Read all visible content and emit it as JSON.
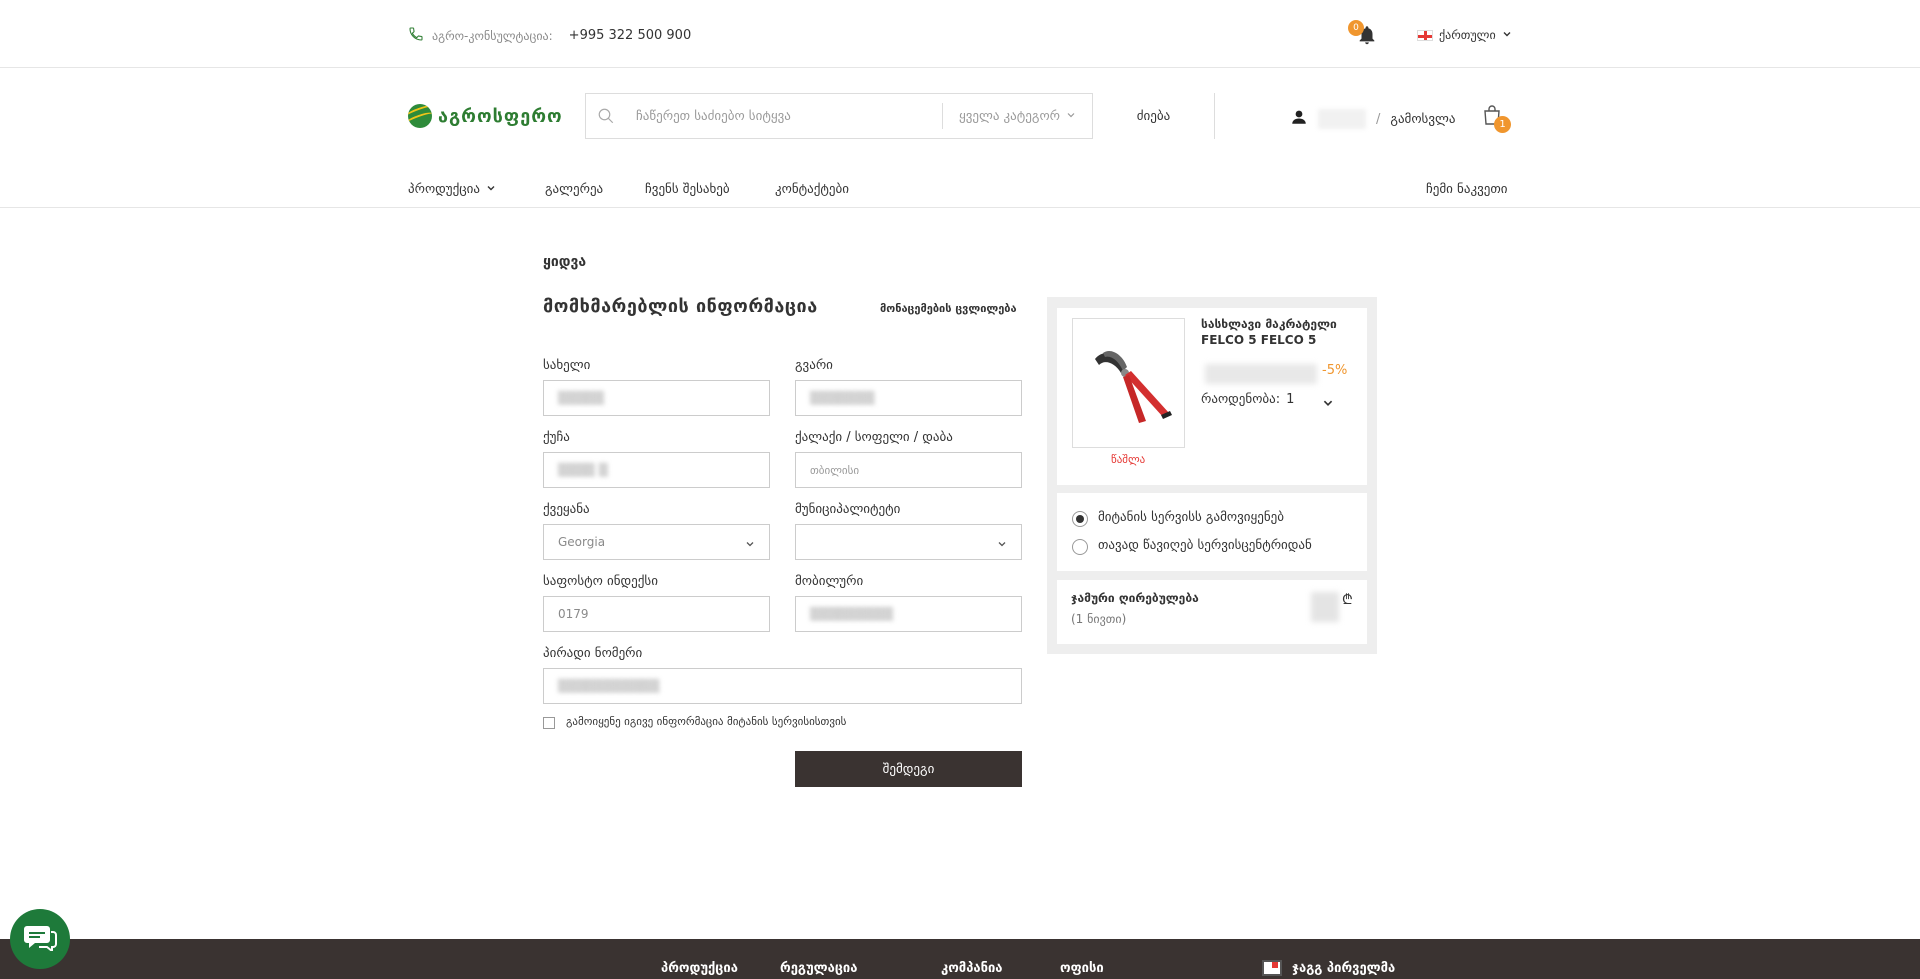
{
  "topbar": {
    "phone_label": "აგრო-კონსულტაცია:",
    "phone_number": "+995 322 500 900",
    "notifications_count": "0",
    "language": "ქართული"
  },
  "header": {
    "logo_text": "აგროსფერო",
    "search_placeholder": "ჩაწერეთ საძიებო სიტყვა",
    "category_select": "ყველა კატეგორ",
    "search_button": "ძიება",
    "separator": "/",
    "logout": "გამოსვლა",
    "cart_count": "1"
  },
  "nav": {
    "products": "პროდუქცია",
    "gallery": "გალერეა",
    "about": "ჩვენს შესახებ",
    "contacts": "კონტაქტები",
    "my_orders": "ჩემი ნაკვეთი"
  },
  "checkout": {
    "breadcrumb": "ყიდვა",
    "title": "მომხმარებლის ინფორმაცია",
    "change_address": "მონაცემების ცვლილება",
    "fields": {
      "first_name_label": "სახელი",
      "last_name_label": "გვარი",
      "street_label": "ქუჩა",
      "city_label": "ქალაქი / სოფელი / დაბა",
      "city_placeholder": "თბილისი",
      "country_label": "ქვეყანა",
      "country_value": "Georgia",
      "municipality_label": "მუნიციპალიტეტი",
      "postal_label": "საფოსტო ინდექსი",
      "postal_value": "0179",
      "mobile_label": "მობილური",
      "personal_id_label": "პირადი ნომერი"
    },
    "same_info_checkbox": "გამოიყენე იგივე ინფორმაცია მიტანის სერვისისთვის",
    "next_button": "შემდეგი"
  },
  "order": {
    "product_title": "სასხლავი მაკრატელი FELCO 5 FELCO 5",
    "discount": "-5%",
    "quantity_label": "რაოდენობა:",
    "quantity_value": "1",
    "remove": "წაშლა",
    "delivery_option": "მიტანის სერვისს გამოვიყენებ",
    "pickup_option": "თავად წავიღებ სერვისცენტრიდან",
    "total_label": "ჯამური ღირებულება",
    "total_items": "(1 ნივთი)",
    "currency": "₾"
  },
  "footer": {
    "products": "პროდუქცია",
    "regulation": "რეგულაცია",
    "company": "კომპანია",
    "office": "ოფისი",
    "first_brand": "ჯაგგ პირველმა"
  },
  "colors": {
    "accent_orange": "#f0962e",
    "brand_green": "#2e7d32",
    "dark_button": "#3a3331",
    "remove_red": "#e53935"
  }
}
